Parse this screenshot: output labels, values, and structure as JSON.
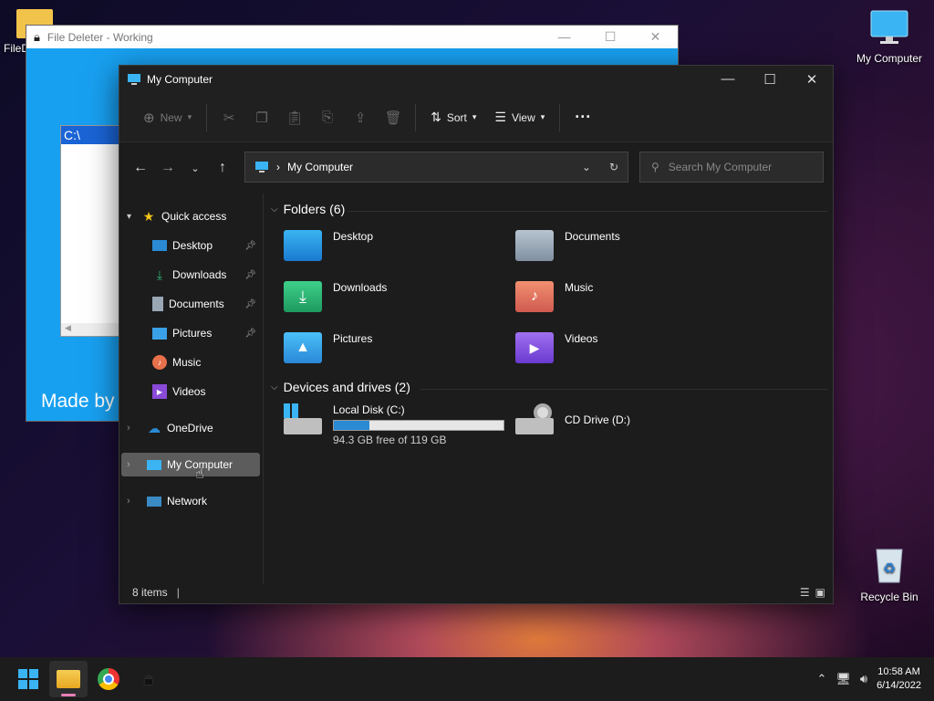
{
  "desktop": {
    "icons": [
      {
        "label": "FileD"
      },
      {
        "label": "My Computer"
      },
      {
        "label": "Recycle Bin"
      }
    ]
  },
  "bg_window": {
    "title": "File Deleter - Working",
    "list_item": "C:\\",
    "footer_text": "Made by"
  },
  "explorer": {
    "title": "My Computer",
    "toolbar": {
      "new_label": "New",
      "sort_label": "Sort",
      "view_label": "View"
    },
    "address": {
      "path": "My Computer",
      "search_placeholder": "Search My Computer"
    },
    "nav": {
      "quick_access": "Quick access",
      "items": [
        "Desktop",
        "Downloads",
        "Documents",
        "Pictures",
        "Music",
        "Videos"
      ],
      "onedrive": "OneDrive",
      "my_computer": "My Computer",
      "network": "Network"
    },
    "folders_header": "Folders (6)",
    "folders": [
      "Desktop",
      "Documents",
      "Downloads",
      "Music",
      "Pictures",
      "Videos"
    ],
    "drives_header": "Devices and drives (2)",
    "drives": [
      {
        "name": "Local Disk (C:)",
        "free": "94.3 GB free of 119 GB",
        "used_fraction": 0.21
      },
      {
        "name": "CD Drive (D:)"
      }
    ],
    "status": "8 items"
  },
  "taskbar": {
    "time": "10:58 AM",
    "date": "6/14/2022"
  },
  "colors": {
    "accent": "#0078d4",
    "folder_blue": "#3aa0e8",
    "folder_green": "#2eb070"
  }
}
